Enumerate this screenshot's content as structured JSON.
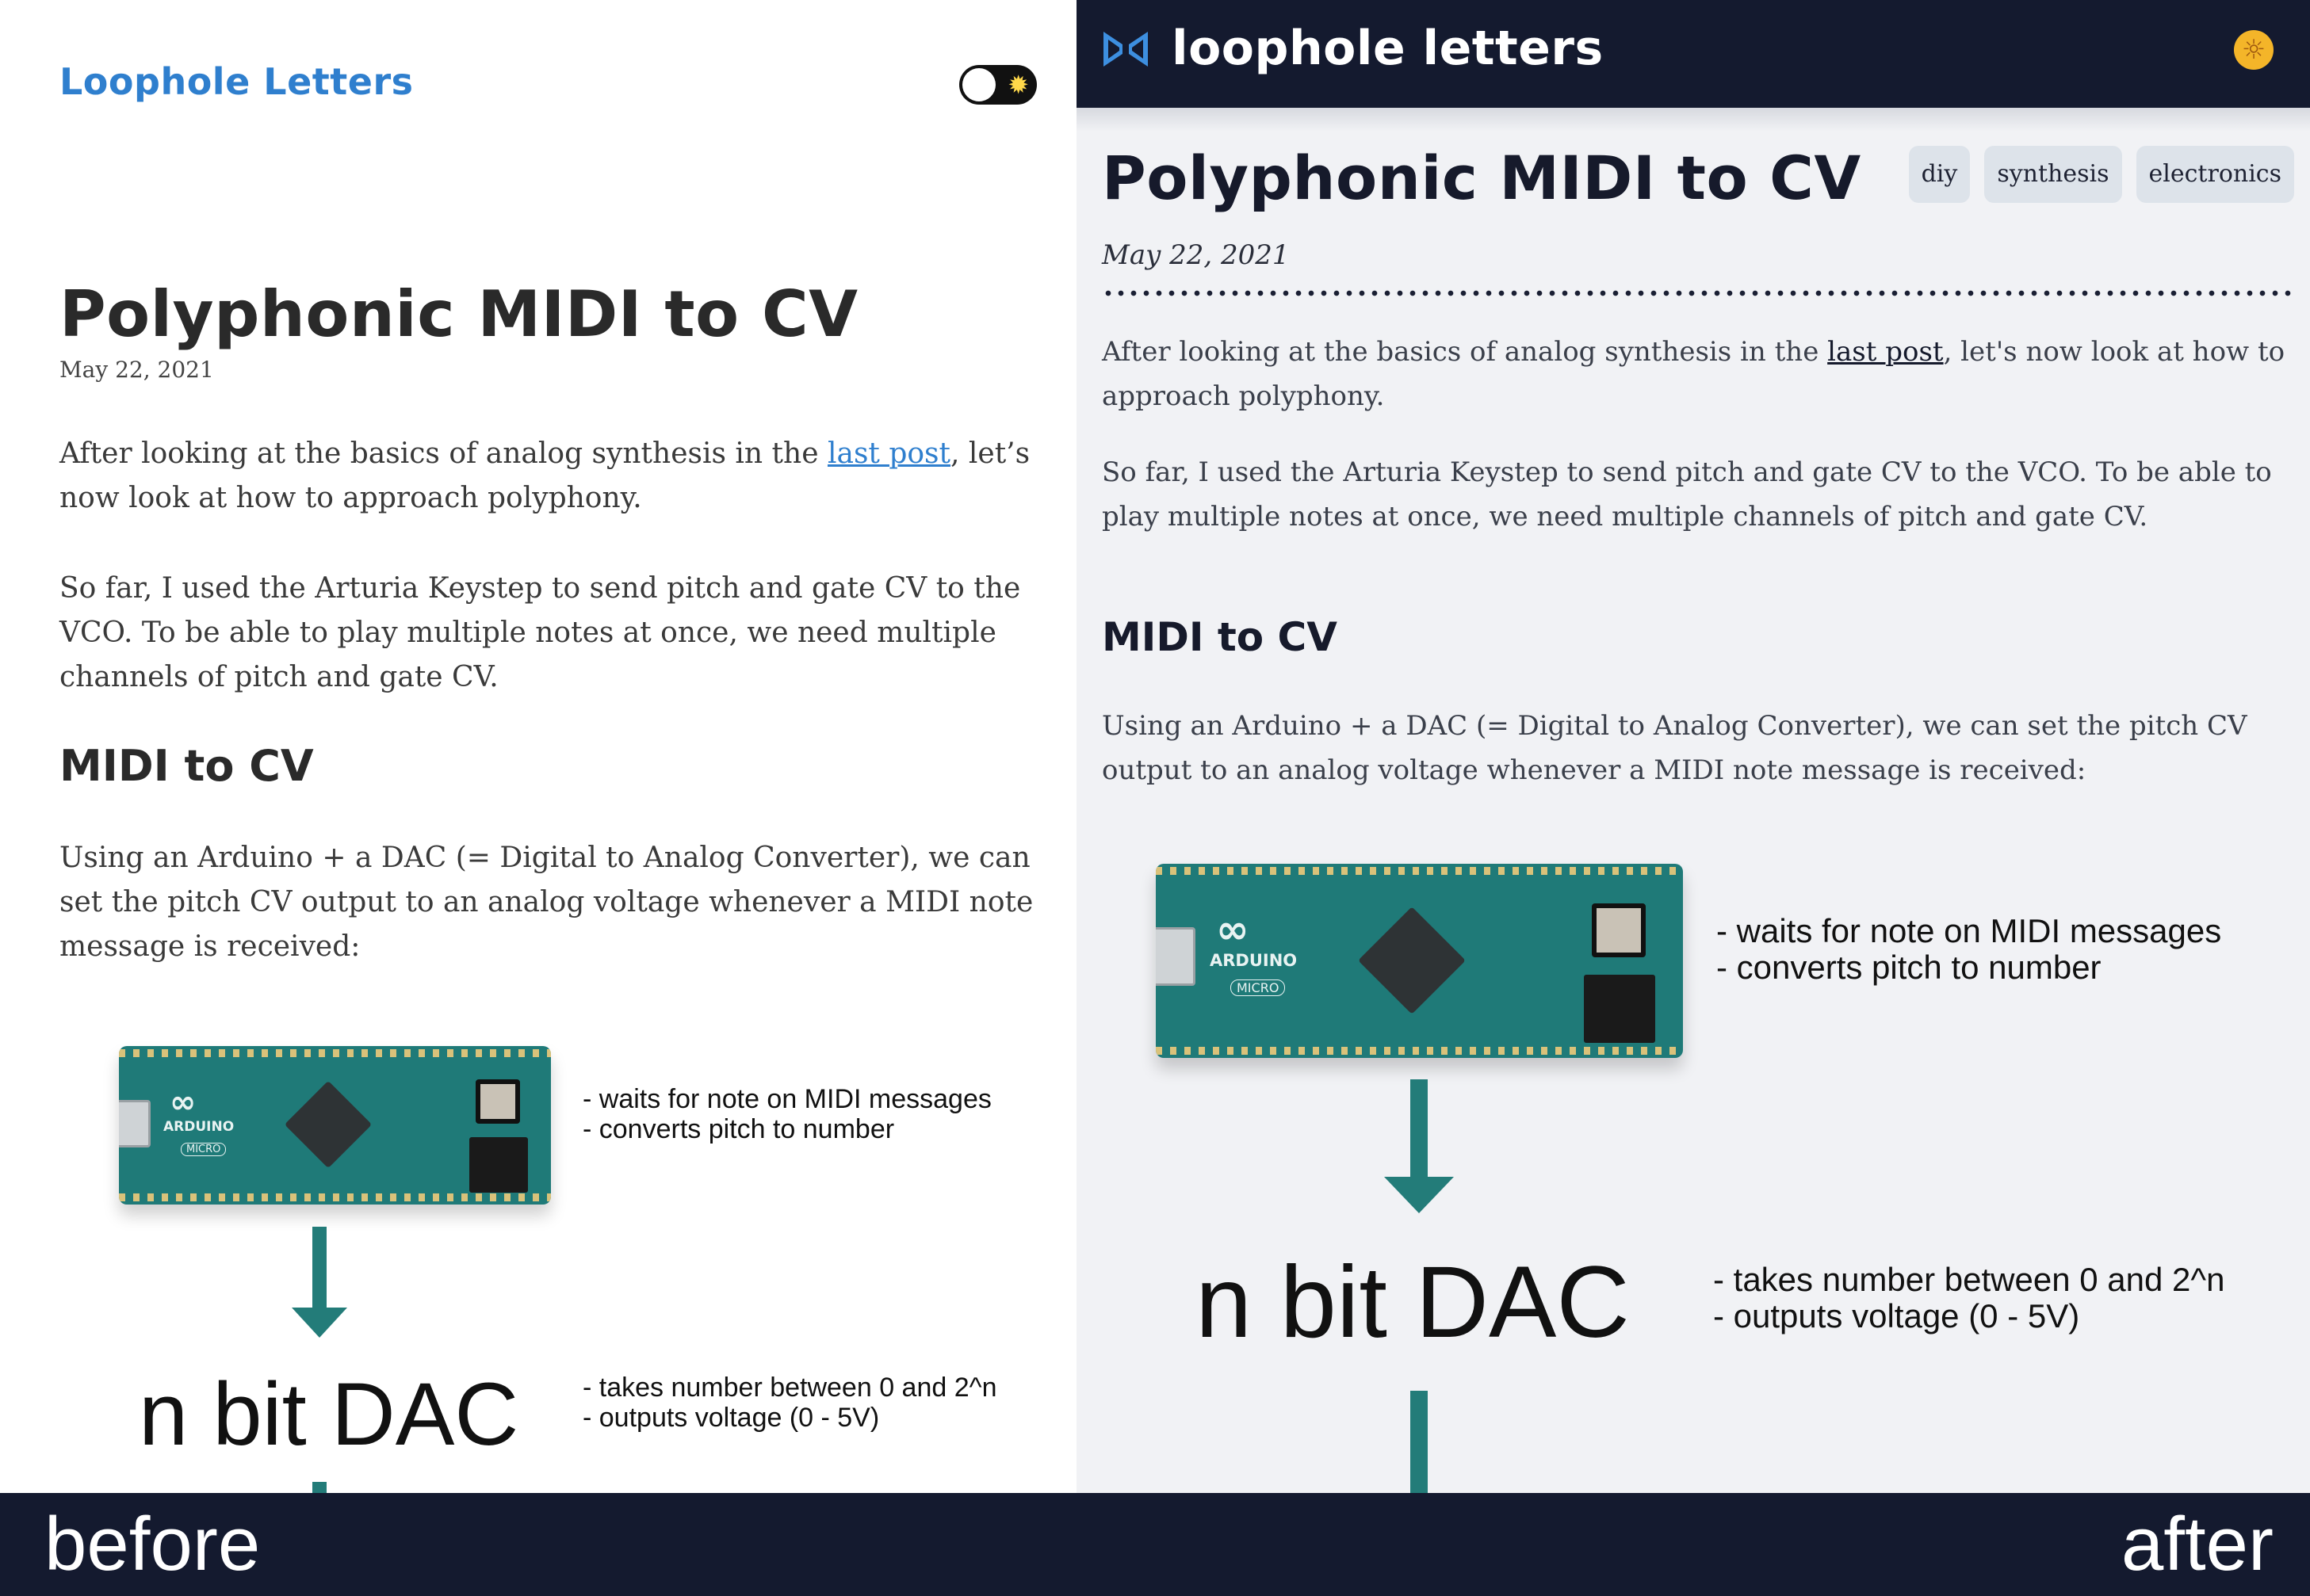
{
  "before": {
    "brand": "Loophole Letters",
    "title": "Polyphonic MIDI to CV",
    "date": "May 22, 2021",
    "para1_pre": "After looking at the basics of analog synthesis in the ",
    "para1_link": "last post",
    "para1_post": ", let’s now look at how to approach polyphony.",
    "para2": "So far, I used the Arturia Keystep to send pitch and gate CV to the VCO. To be able to play multiple notes at once, we need multiple channels of pitch and gate CV.",
    "heading": "MIDI to CV",
    "para3": "Using an Arduino + a DAC (= Digital to Analog Converter), we can set the pitch CV output to an analog voltage whenever a MIDI note message is received:"
  },
  "after": {
    "brand": "loophole letters",
    "title": "Polyphonic MIDI to CV",
    "tags": [
      "diy",
      "synthesis",
      "electronics"
    ],
    "date": "May 22, 2021",
    "para1_pre": "After looking at the basics of analog synthesis in the ",
    "para1_link": "last post",
    "para1_post": ", let's now look at how to approach polyphony.",
    "para2": "So far, I used the Arturia Keystep to send pitch and gate CV to the VCO. To be able to play multiple notes at once, we need multiple channels of pitch and gate CV.",
    "heading": "MIDI to CV",
    "para3": "Using an Arduino + a DAC (= Digital to Analog Converter), we can set the pitch CV output to an analog voltage whenever a MIDI note message is received:"
  },
  "diagram": {
    "board_label": "ARDUINO",
    "board_sublabel": "MICRO",
    "arduino_note_1": "- waits for note on MIDI messages",
    "arduino_note_2": "- converts pitch to number",
    "dac_label": "n bit DAC",
    "dac_note_1": "- takes number between 0 and 2^n",
    "dac_note_2": "- outputs voltage (0 - 5V)"
  },
  "labels": {
    "before": "before",
    "after": "after"
  },
  "colors": {
    "link_blue": "#2f7fce",
    "navbar": "#141a2f",
    "teal_arrow": "#237c79",
    "toggle_sun": "#ffd84a",
    "nav_sun": "#f4b529"
  },
  "icons": {
    "toggle": "sun-toggle-icon",
    "nav_logo": "bowtie-logo-icon",
    "theme": "sun-icon"
  }
}
